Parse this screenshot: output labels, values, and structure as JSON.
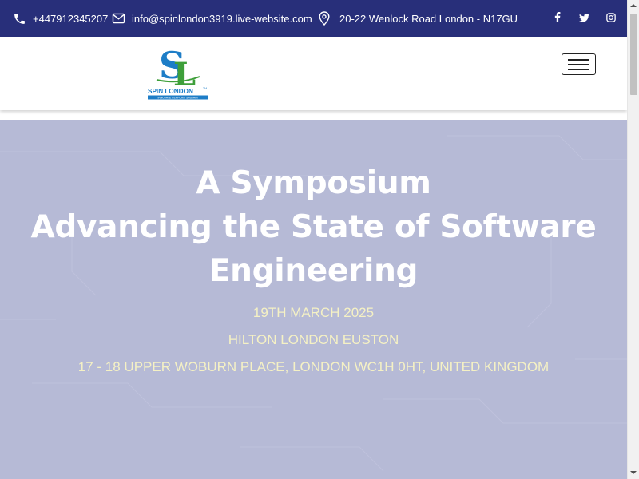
{
  "topbar": {
    "phone": "+447912345207",
    "email": "info@spinlondon3919.live-website.com",
    "address": "20-22 Wenlock Road London - N17GU",
    "icons": {
      "phone": "phone-icon",
      "email": "envelope-icon",
      "address": "map-pin-icon"
    },
    "social": [
      {
        "name": "facebook",
        "glyph": "f"
      },
      {
        "name": "twitter",
        "glyph": "twitter-bird"
      },
      {
        "name": "instagram",
        "glyph": "instagram-camera"
      }
    ]
  },
  "header": {
    "logo": {
      "monogram_s": "S",
      "monogram_l": "L",
      "wordmark": "SPIN LONDON",
      "trademark": "TM",
      "tagline": "INNOVATE PERFORM SUSTAIN"
    },
    "menu_toggle_icon": "hamburger-icon"
  },
  "hero": {
    "title_lines": [
      "A Symposium",
      "Advancing the State of Software",
      "Engineering"
    ],
    "date": "19TH MARCH 2025",
    "venue": "HILTON LONDON EUSTON",
    "address": "17 - 18 UPPER WOBURN PLACE, LONDON WC1H 0HT, UNITED KINGDOM"
  },
  "colors": {
    "topbar_bg": "#282f7a",
    "hero_bg": "#b6bad6",
    "hero_title": "#ffffff",
    "hero_info": "#f5f1c4",
    "logo_blue": "#1d7dc7",
    "logo_green": "#3e9f3a"
  }
}
